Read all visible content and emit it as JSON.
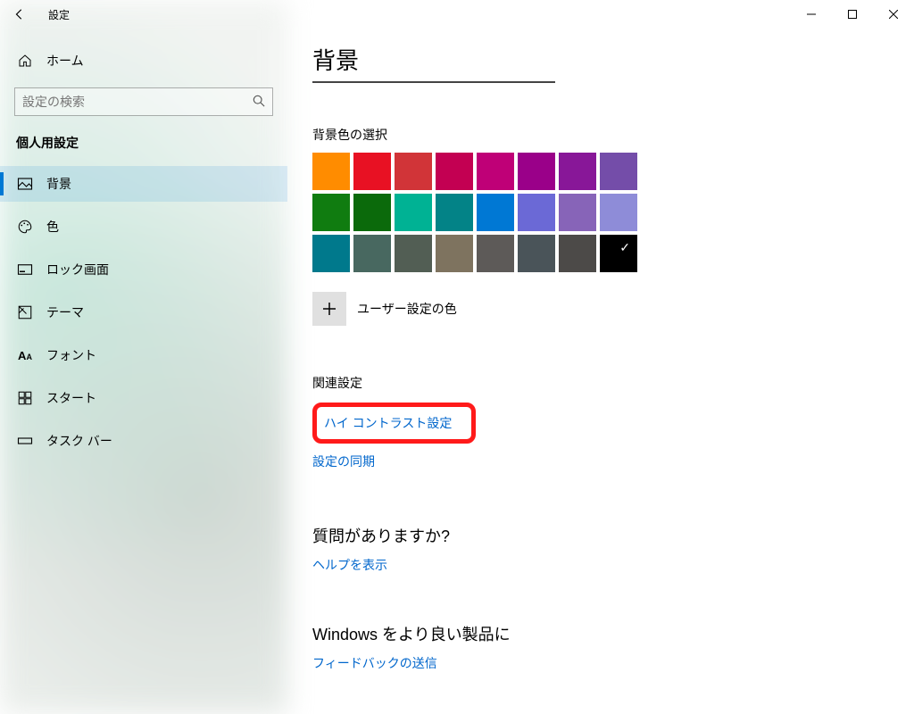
{
  "window": {
    "title": "設定",
    "controls": {
      "min": "—",
      "max": "☐",
      "close": "✕"
    }
  },
  "sidebar": {
    "home": "ホーム",
    "search_placeholder": "設定の検索",
    "section": "個人用設定",
    "items": [
      {
        "label": "背景",
        "selected": true
      },
      {
        "label": "色",
        "selected": false
      },
      {
        "label": "ロック画面",
        "selected": false
      },
      {
        "label": "テーマ",
        "selected": false
      },
      {
        "label": "フォント",
        "selected": false
      },
      {
        "label": "スタート",
        "selected": false
      },
      {
        "label": "タスク バー",
        "selected": false
      }
    ]
  },
  "main": {
    "heading": "背景",
    "bgcolor_label": "背景色の選択",
    "colors": [
      [
        "#ff8c00",
        "#e81123",
        "#d13438",
        "#c30052",
        "#bf0077",
        "#9a0089",
        "#881798",
        "#744da9"
      ],
      [
        "#107c10",
        "#0b6a0b",
        "#00b294",
        "#038387",
        "#0078d4",
        "#6b69d6",
        "#8764b8",
        "#8e8cd8"
      ],
      [
        "#00798c",
        "#486860",
        "#525e54",
        "#7e735f",
        "#5d5a58",
        "#4a5459",
        "#4c4a48",
        "#000000"
      ]
    ],
    "checked_color": "#000000",
    "custom_color_label": "ユーザー設定の色",
    "related_title": "関連設定",
    "link_high_contrast": "ハイ コントラスト設定",
    "link_sync": "設定の同期",
    "question_title": "質問がありますか?",
    "link_help": "ヘルプを表示",
    "feedback_title": "Windows をより良い製品に",
    "link_feedback": "フィードバックの送信"
  }
}
